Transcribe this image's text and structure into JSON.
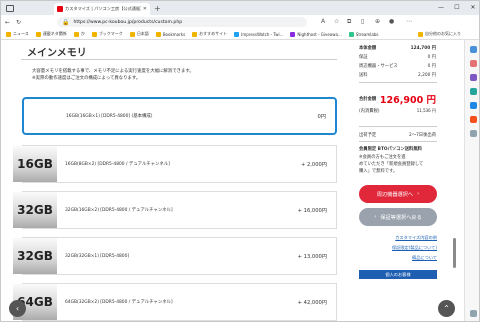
{
  "browser": {
    "tab_title": "カスタマイズ | パソコン工房【公式通販】",
    "url": "https://www.pc-koubou.jp/products/custom.php",
    "bookmarks": [
      "ニュース",
      "連載ネタ関係",
      "か",
      "ブックマーク",
      "日本語",
      "Bookmarks",
      "おすすめサイト",
      "ImpressWatch - Twi...",
      "Nighthost - Giveawa...",
      "Streamlabs",
      "自分他のお気に入り"
    ]
  },
  "section": {
    "title": "メインメモリ",
    "desc_line1": "大容量メモリを搭載する事で、メモリ不足による実行速度を大幅に解消できます。",
    "desc_line2": "※実際の動作速度はご注文の構成によって異なります。"
  },
  "options": [
    {
      "chip": "",
      "name": "16GB(16GB×1) [DDR5-4800] (基本構成)",
      "price": "0円",
      "selected": true
    },
    {
      "chip": "16GB",
      "name": "16GB(8GB×2) [DDR5-4800 / デュアルチャンネル]",
      "price": "+ 2,000円",
      "selected": false
    },
    {
      "chip": "32GB",
      "name": "32GB(16GB×2) [DDR5-4800 / デュアルチャンネル]",
      "price": "+ 16,000円",
      "selected": false
    },
    {
      "chip": "32GB",
      "name": "32GB(32GB×1) [DDR5-4800]",
      "price": "+ 13,000円",
      "selected": false
    },
    {
      "chip": "64GB",
      "name": "64GB(32GB×2) [DDR5-4800 / デュアルチャンネル]",
      "price": "+ 42,000円",
      "selected": false
    }
  ],
  "summary": {
    "base_label": "本体金額",
    "base_value": "124,700 円",
    "guarantee_label": "保証",
    "guarantee_value": "0 円",
    "peripheral_label": "周辺機器・サービス",
    "peripheral_value": "0 円",
    "shipping_label": "送料",
    "shipping_value": "2,200 円",
    "total_label": "合計金額",
    "total_value": "126,900 円",
    "tax_label": "(内消費税)",
    "tax_value": "11,536 円",
    "ship_date_label": "出荷予定",
    "ship_date_value": "2〜7日後出荷",
    "note1": "会員限定 BTOパソコン送料無料",
    "note2": "※会員の方もご注文を進",
    "note3": "めていただき「新規会員登録して",
    "note4": "購入」で無料です。",
    "btn_next": "周辺機器選択へ",
    "btn_back": "保証等選択へ戻る",
    "link1": "カスタマイズ内容の例",
    "link2": "保証限定(製品について)",
    "link3": "備品について",
    "btn_blue": "個人のお客様"
  },
  "colors": {
    "accent_red": "#e60012",
    "select_blue": "#1f86d1",
    "link_blue": "#1a5fb4"
  }
}
